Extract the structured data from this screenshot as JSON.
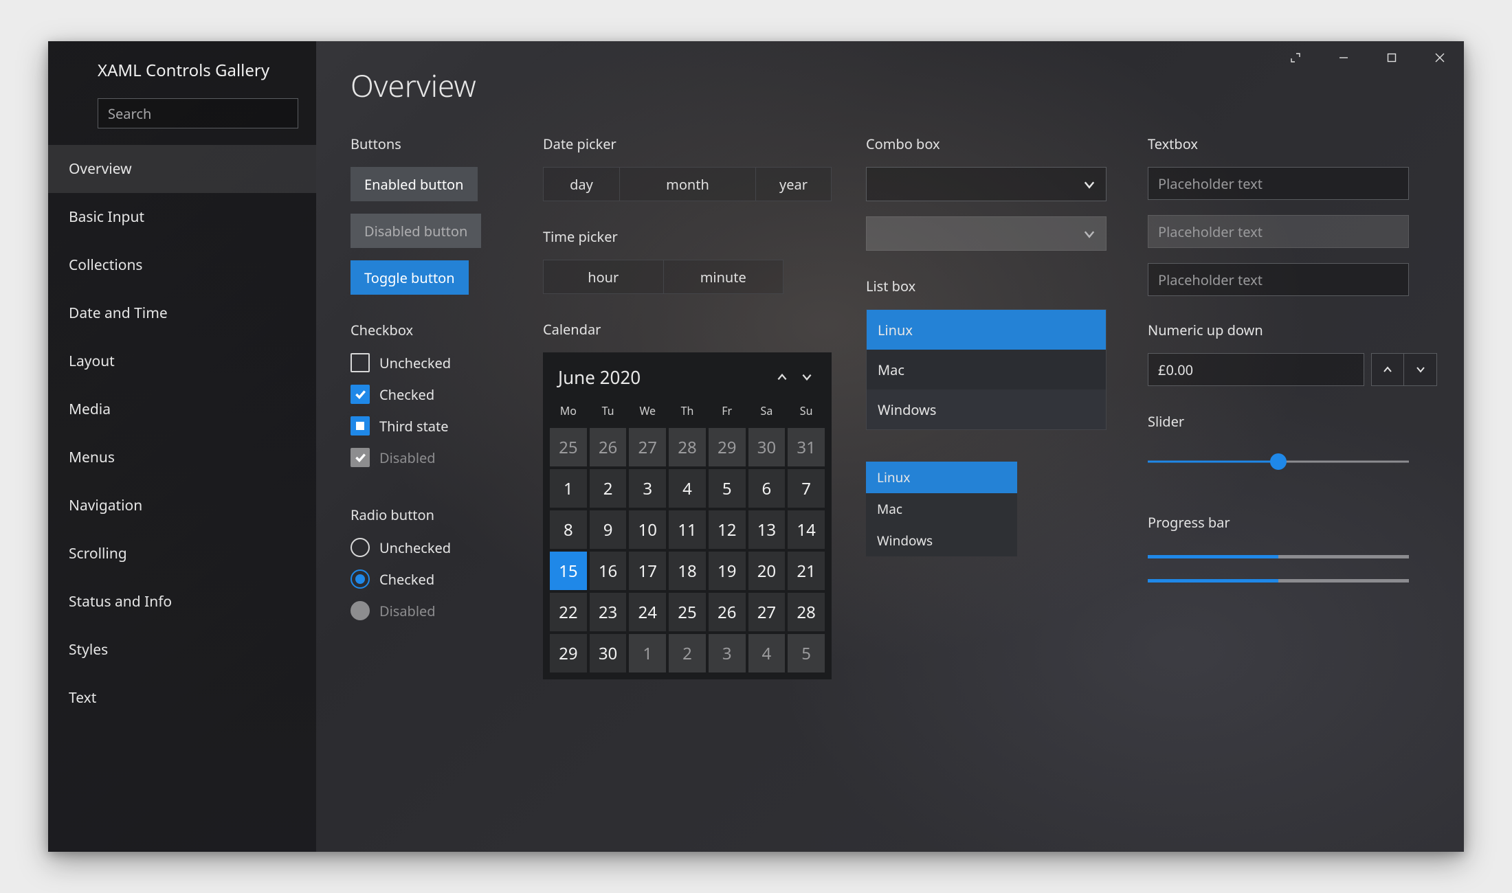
{
  "app": {
    "title": "XAML Controls Gallery"
  },
  "search": {
    "placeholder": "Search"
  },
  "sidebar": {
    "items": [
      {
        "label": "Overview",
        "selected": true
      },
      {
        "label": "Basic Input"
      },
      {
        "label": "Collections"
      },
      {
        "label": "Date and Time"
      },
      {
        "label": "Layout"
      },
      {
        "label": "Media"
      },
      {
        "label": "Menus"
      },
      {
        "label": "Navigation"
      },
      {
        "label": "Scrolling"
      },
      {
        "label": "Status and Info"
      },
      {
        "label": "Styles"
      },
      {
        "label": "Text"
      }
    ]
  },
  "page": {
    "title": "Overview"
  },
  "sections": {
    "buttons": "Buttons",
    "checkbox": "Checkbox",
    "radio": "Radio button",
    "date_picker": "Date picker",
    "time_picker": "Time picker",
    "calendar": "Calendar",
    "combo": "Combo box",
    "listbox": "List box",
    "textbox": "Textbox",
    "numeric": "Numeric up down",
    "slider": "Slider",
    "progress": "Progress bar"
  },
  "buttons": {
    "enabled": "Enabled button",
    "disabled": "Disabled button",
    "toggle": "Toggle button"
  },
  "checkboxes": [
    {
      "label": "Unchecked",
      "state": "unchecked"
    },
    {
      "label": "Checked",
      "state": "checked"
    },
    {
      "label": "Third state",
      "state": "third"
    },
    {
      "label": "Disabled",
      "state": "disabled"
    }
  ],
  "radios": [
    {
      "label": "Unchecked",
      "state": "unchecked"
    },
    {
      "label": "Checked",
      "state": "checked"
    },
    {
      "label": "Disabled",
      "state": "disabled"
    }
  ],
  "date_picker": {
    "day": "day",
    "month": "month",
    "year": "year"
  },
  "time_picker": {
    "hour": "hour",
    "minute": "minute"
  },
  "calendar": {
    "title": "June 2020",
    "dow": [
      "Mo",
      "Tu",
      "We",
      "Th",
      "Fr",
      "Sa",
      "Su"
    ],
    "days": [
      {
        "n": 25,
        "dim": true
      },
      {
        "n": 26,
        "dim": true
      },
      {
        "n": 27,
        "dim": true
      },
      {
        "n": 28,
        "dim": true
      },
      {
        "n": 29,
        "dim": true
      },
      {
        "n": 30,
        "dim": true
      },
      {
        "n": 31,
        "dim": true
      },
      {
        "n": 1
      },
      {
        "n": 2
      },
      {
        "n": 3
      },
      {
        "n": 4
      },
      {
        "n": 5
      },
      {
        "n": 6
      },
      {
        "n": 7
      },
      {
        "n": 8
      },
      {
        "n": 9
      },
      {
        "n": 10
      },
      {
        "n": 11
      },
      {
        "n": 12
      },
      {
        "n": 13
      },
      {
        "n": 14
      },
      {
        "n": 15,
        "sel": true
      },
      {
        "n": 16
      },
      {
        "n": 17
      },
      {
        "n": 18
      },
      {
        "n": 19
      },
      {
        "n": 20
      },
      {
        "n": 21
      },
      {
        "n": 22
      },
      {
        "n": 23
      },
      {
        "n": 24
      },
      {
        "n": 25
      },
      {
        "n": 26
      },
      {
        "n": 27
      },
      {
        "n": 28
      },
      {
        "n": 29
      },
      {
        "n": 30
      },
      {
        "n": 1,
        "dim": true
      },
      {
        "n": 2,
        "dim": true
      },
      {
        "n": 3,
        "dim": true
      },
      {
        "n": 4,
        "dim": true
      },
      {
        "n": 5,
        "dim": true
      }
    ]
  },
  "listbox": {
    "items": [
      {
        "label": "Linux",
        "sel": true
      },
      {
        "label": "Mac"
      },
      {
        "label": "Windows"
      }
    ]
  },
  "listbox2": {
    "items": [
      {
        "label": "Linux",
        "sel": true
      },
      {
        "label": "Mac"
      },
      {
        "label": "Windows"
      }
    ]
  },
  "textboxes": {
    "t1": {
      "placeholder": "Placeholder text"
    },
    "t2": {
      "placeholder": "Placeholder text"
    },
    "t3": {
      "placeholder": "Placeholder text"
    }
  },
  "numeric": {
    "value": "£0.00"
  },
  "slider": {
    "value": 50
  },
  "progress": {
    "p1": 50,
    "p2": 50
  }
}
